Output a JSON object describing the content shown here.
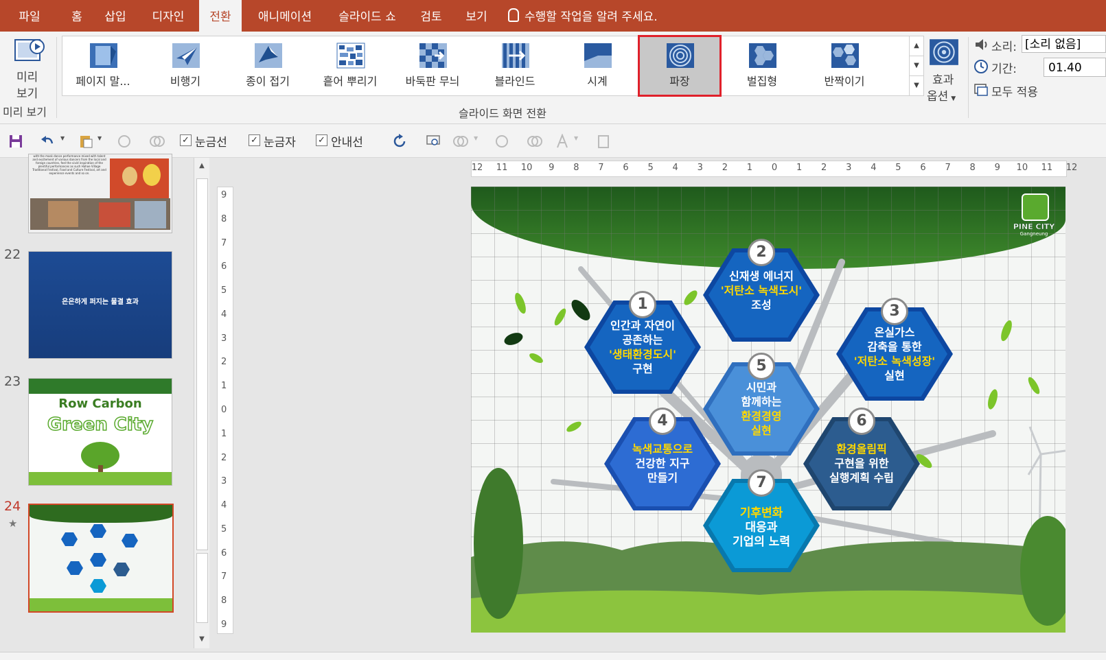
{
  "menu": {
    "tabs": [
      "파일",
      "홈",
      "삽입",
      "디자인",
      "전환",
      "애니메이션",
      "슬라이드 쇼",
      "검토",
      "보기"
    ],
    "active_tab": "전환",
    "tell_me": "수행할 작업을 알려 주세요."
  },
  "ribbon": {
    "preview": {
      "label_line1": "미리",
      "label_line2": "보기",
      "group": "미리 보기"
    },
    "gallery": [
      {
        "label": "페이지 말...",
        "icon": "page-curl-icon"
      },
      {
        "label": "비행기",
        "icon": "airplane-icon"
      },
      {
        "label": "종이 접기",
        "icon": "origami-icon"
      },
      {
        "label": "흩어 뿌리기",
        "icon": "scatter-icon"
      },
      {
        "label": "바둑판 무늬",
        "icon": "checkerboard-icon"
      },
      {
        "label": "블라인드",
        "icon": "blinds-icon"
      },
      {
        "label": "시계",
        "icon": "clock-wipe-icon"
      },
      {
        "label": "파장",
        "icon": "ripple-icon",
        "selected": true
      },
      {
        "label": "벌집형",
        "icon": "honeycomb-icon"
      },
      {
        "label": "반짝이기",
        "icon": "glitter-icon"
      }
    ],
    "group_label": "슬라이드 화면 전환",
    "effect_options": {
      "line1": "효과",
      "line2": "옵션"
    },
    "timing": {
      "sound_label": "소리:",
      "sound_value": "[소리 없음]",
      "duration_label": "기간:",
      "duration_value": "01.40",
      "apply_all": "모두 적용"
    }
  },
  "qat": {
    "gridlines": "눈금선",
    "ruler": "눈금자",
    "guides": "안내선"
  },
  "thumbnails": {
    "slide21_text": "with the mask dance performance mixed with talent and excitement of various dancers from the local and foreign countries, feel the vivid inspiration of the plentiful performances as such Hahoe Village Traditional Festival, Food and Culture Festival, art and experience events and so on.",
    "slide22": {
      "number": "22",
      "text": "은은하게 퍼지는 물결 효과"
    },
    "slide23": {
      "number": "23",
      "line1": "Row Carbon",
      "line2": "Green City"
    },
    "slide24": {
      "number": "24",
      "star": "★"
    }
  },
  "ruler": {
    "h_ticks": [
      "12",
      "11",
      "10",
      "9",
      "8",
      "7",
      "6",
      "5",
      "4",
      "3",
      "2",
      "1",
      "0",
      "1",
      "2",
      "3",
      "4",
      "5",
      "6",
      "7",
      "8",
      "9",
      "10",
      "11",
      "12"
    ],
    "v_ticks": [
      "9",
      "8",
      "7",
      "6",
      "5",
      "4",
      "3",
      "2",
      "1",
      "0",
      "1",
      "2",
      "3",
      "4",
      "5",
      "6",
      "7",
      "8",
      "9"
    ]
  },
  "slide": {
    "logo_line1": "PINE CITY",
    "logo_line2": "Gangneung",
    "items": [
      {
        "num": "1",
        "lines": [
          "인간과 자연이",
          "공존하는"
        ],
        "hl": "'생태환경도시'",
        "tail": "구현"
      },
      {
        "num": "2",
        "lines": [
          "신재생 에너지"
        ],
        "hl": "'저탄소 녹색도시'",
        "tail": "조성"
      },
      {
        "num": "3",
        "lines": [
          "온실가스",
          "감축을 통한"
        ],
        "hl": "'저탄소 녹색성장'",
        "tail": "실현"
      },
      {
        "num": "4",
        "hl": "녹색교통으로",
        "lines": [
          "건강한 지구",
          "만들기"
        ]
      },
      {
        "num": "5",
        "lines": [
          "시민과",
          "함께하는"
        ],
        "hl": "환경경영",
        "tail": "실현"
      },
      {
        "num": "6",
        "hl": "환경올림픽",
        "lines": [
          "구현을 위한",
          "실행계획 수립"
        ]
      },
      {
        "num": "7",
        "hl": "기후변화",
        "lines": [
          "대응과",
          "기업의 노력"
        ]
      }
    ]
  },
  "colors": {
    "accent": "#b7472a",
    "selected_outline": "#e0202a",
    "hex_blue": "#1565c0",
    "hex_light": "#4a90d9",
    "hex_dark": "#2c5c8f",
    "hex_cyan": "#0b9ad6",
    "highlight_text": "#ffd800"
  }
}
